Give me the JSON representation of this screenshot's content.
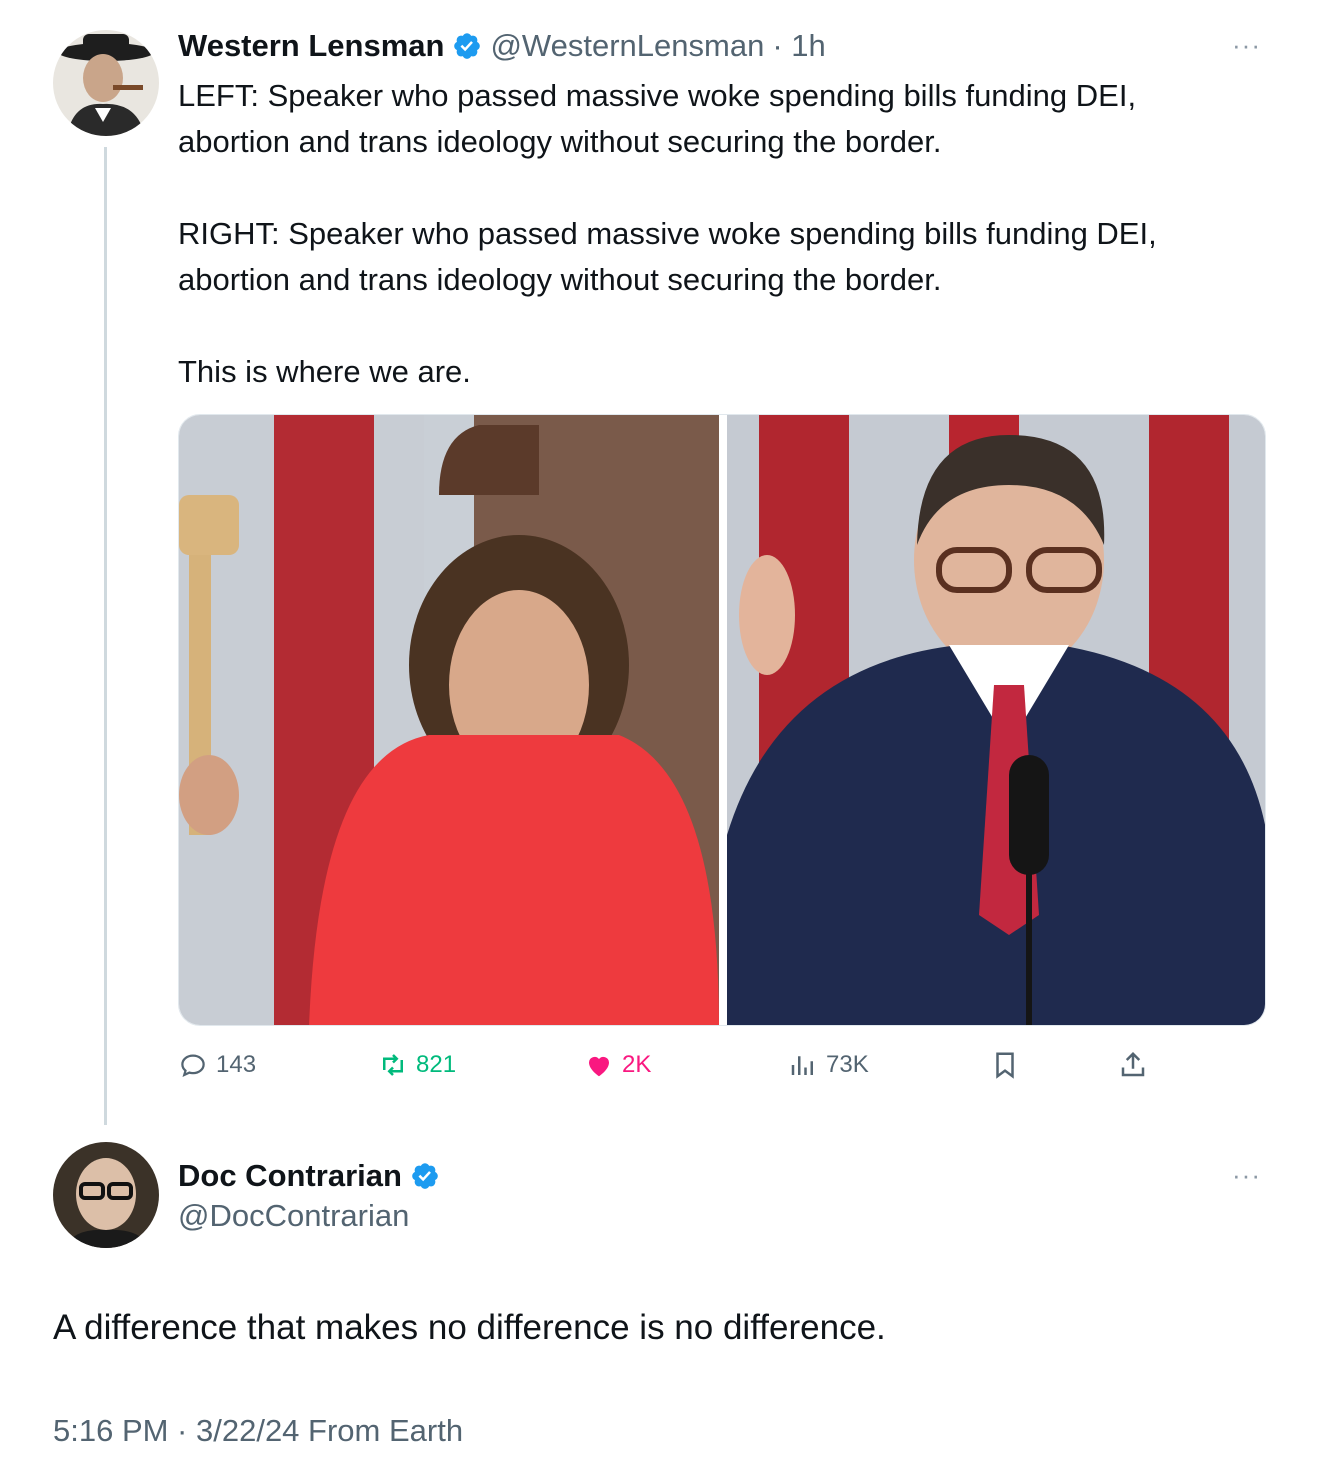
{
  "tweet": {
    "name": "Western Lensman",
    "handle": "@WesternLensman",
    "time": "· 1h",
    "text_line1": "LEFT: Speaker who passed massive woke spending bills funding DEI,",
    "text_line2": "abortion and trans ideology without securing the border.",
    "text_line3": "RIGHT: Speaker who passed massive woke spending bills funding DEI,",
    "text_line4": "abortion and trans ideology without securing the border.",
    "text_line5": "This is where we are.",
    "more": "···",
    "actions": {
      "replies": "143",
      "retweets": "821",
      "likes": "2K",
      "views": "73K"
    },
    "colors": {
      "retweet": "#00ba7c",
      "like": "#f91880",
      "verified": "#1d9bf0",
      "muted": "#536471"
    }
  },
  "reply": {
    "name": "Doc Contrarian",
    "handle": "@DocContrarian",
    "more": "···",
    "text": "A difference that makes no difference is no difference.",
    "meta": "5:16 PM · 3/22/24 From Earth"
  }
}
